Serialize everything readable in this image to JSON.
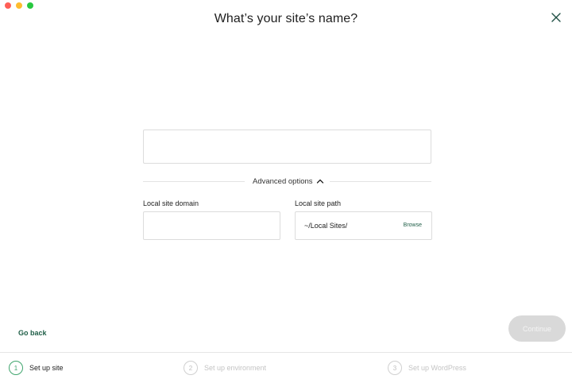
{
  "window": {
    "traffic_lights": [
      "close",
      "minimize",
      "zoom"
    ],
    "title": "What’s your site’s name?",
    "close_icon": "close-x-icon"
  },
  "form": {
    "site_name": {
      "value": "",
      "placeholder": ""
    },
    "advanced_options_label": "Advanced options",
    "advanced_expanded": true,
    "local_site_domain": {
      "label": "Local site domain",
      "value": ""
    },
    "local_site_path": {
      "label": "Local site path",
      "value": "~/Local Sites/",
      "browse_label": "Browse"
    }
  },
  "footer": {
    "go_back_label": "Go back",
    "continue_label": "Continue",
    "continue_enabled": false
  },
  "steps": [
    {
      "number": "1",
      "label": "Set up site",
      "active": true
    },
    {
      "number": "2",
      "label": "Set up environment",
      "active": false
    },
    {
      "number": "3",
      "label": "Set up WordPress",
      "active": false
    }
  ],
  "colors": {
    "accent_green": "#3fa56d",
    "link_green": "#1f5e47",
    "disabled_button": "#d9d9d9"
  }
}
